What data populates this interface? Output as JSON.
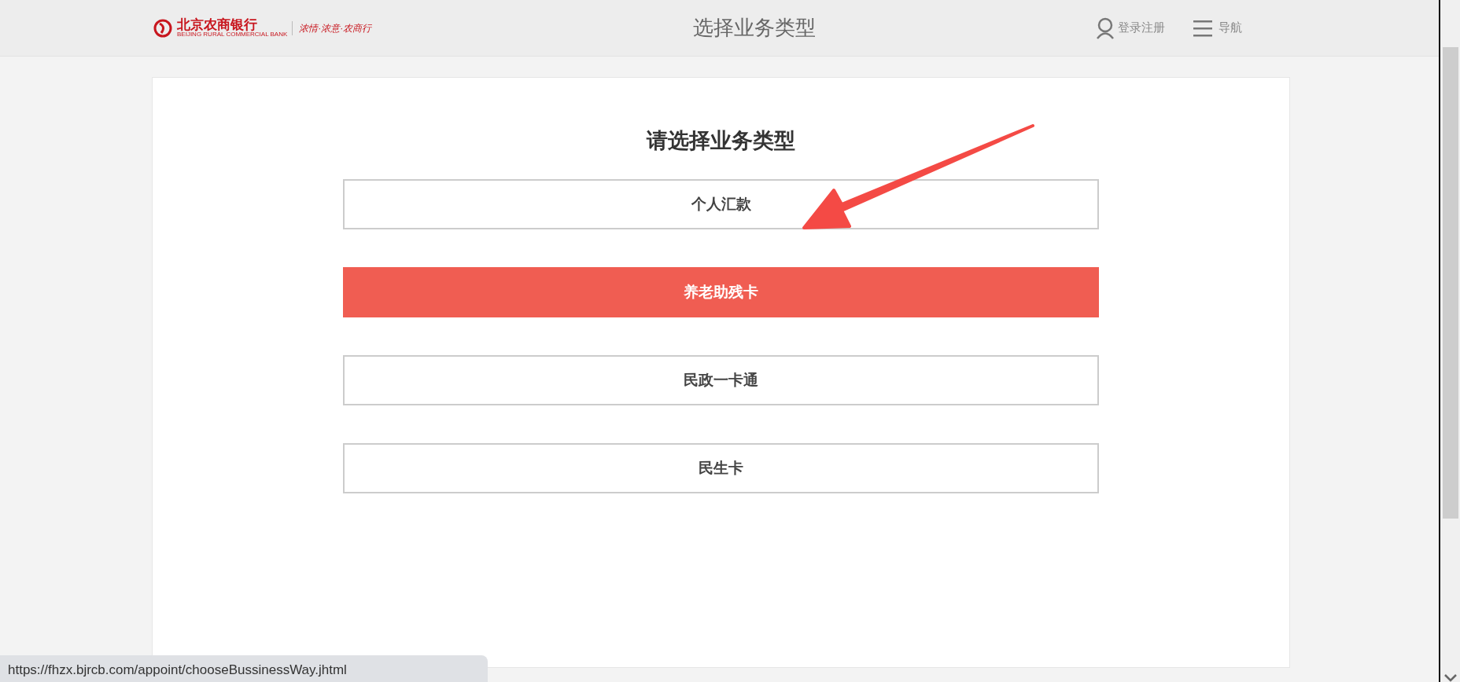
{
  "header": {
    "logo_name": "北京农商银行",
    "logo_subtitle": "BEIJING RURAL COMMERCIAL BANK",
    "slogan": "浓情·浓意·农商行",
    "title": "选择业务类型",
    "login": "登录注册",
    "nav": "导航"
  },
  "heading": "请选择业务类型",
  "options": [
    {
      "label": "个人汇款",
      "selected": false
    },
    {
      "label": "养老助残卡",
      "selected": true
    },
    {
      "label": "民政一卡通",
      "selected": false
    },
    {
      "label": "民生卡",
      "selected": false
    }
  ],
  "status_url": "https://fhzx.bjrcb.com/appoint/chooseBussinessWay.jhtml"
}
